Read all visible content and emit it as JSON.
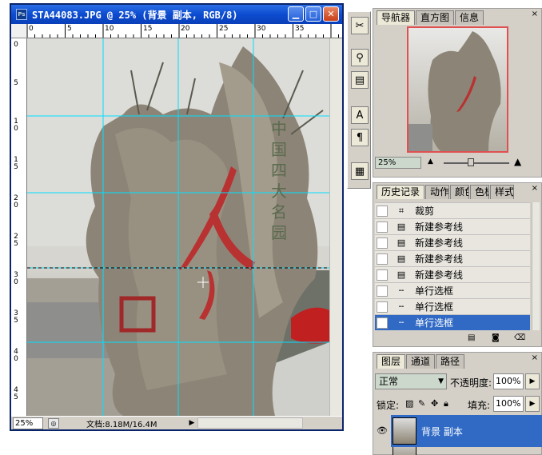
{
  "document": {
    "title": "STA44083.JPG @ 25% (背景 副本, RGB/8)",
    "app_icon": "Ps",
    "zoom": "25%",
    "status_info": "文档:8.18M/16.4M",
    "ruler_h_labels": [
      "0",
      "5",
      "10",
      "15",
      "20",
      "25",
      "30",
      "35"
    ],
    "ruler_v_labels": [
      "0",
      "5",
      "10",
      "15",
      "20",
      "25",
      "30",
      "35",
      "40",
      "45"
    ],
    "engraving": "中国四大名园"
  },
  "colors": {
    "titlebar": "#0c4cd0",
    "guide": "#00e0ff",
    "selection": "#316ac5",
    "nav_frame": "#e05050"
  },
  "tools": [
    "tools-icon",
    "clone-stamp-icon",
    "stamp-icon",
    "type-icon",
    "paragraph-icon",
    "panel-icon"
  ],
  "navigator": {
    "tabs": [
      "导航器",
      "直方图",
      "信息"
    ],
    "zoom": "25%"
  },
  "history": {
    "tabs": [
      "历史记录",
      "动作",
      "颜色",
      "色板",
      "样式"
    ],
    "items": [
      {
        "label": "裁剪",
        "icon": "crop-icon"
      },
      {
        "label": "新建参考线",
        "icon": "document-icon"
      },
      {
        "label": "新建参考线",
        "icon": "document-icon"
      },
      {
        "label": "新建参考线",
        "icon": "document-icon"
      },
      {
        "label": "新建参考线",
        "icon": "document-icon"
      },
      {
        "label": "单行选框",
        "icon": "marquee-icon"
      },
      {
        "label": "单行选框",
        "icon": "marquee-icon"
      },
      {
        "label": "单行选框",
        "icon": "marquee-icon"
      }
    ]
  },
  "layers": {
    "tabs": [
      "图层",
      "通道",
      "路径"
    ],
    "blend_mode": "正常",
    "opacity_label": "不透明度:",
    "opacity": "100%",
    "lock_label": "锁定:",
    "fill_label": "填充:",
    "fill": "100%",
    "items": [
      {
        "name": "背景 副本",
        "selected": true
      },
      {
        "name": "",
        "selected": false
      }
    ]
  }
}
